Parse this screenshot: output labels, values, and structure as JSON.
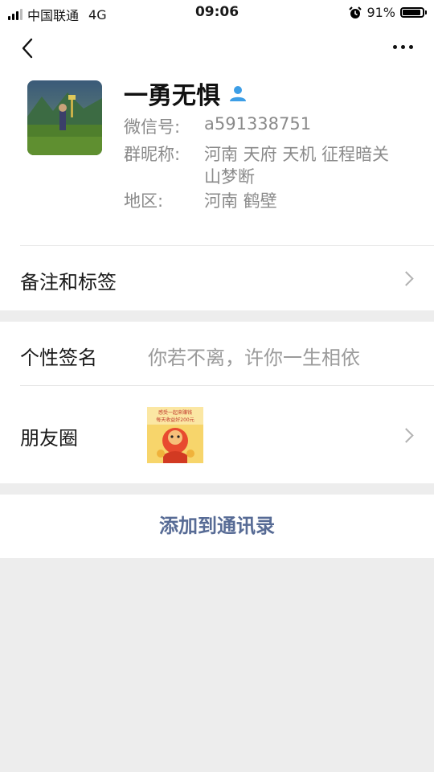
{
  "status_bar": {
    "carrier": "中国联通",
    "network": "4G",
    "time": "09:06",
    "battery_percent": "91%",
    "battery_level": 0.91
  },
  "nav": {
    "back_icon": "chevron-left-icon",
    "more_icon": "more-dots-icon"
  },
  "profile": {
    "nickname": "一勇无惧",
    "gender_icon": "person-icon",
    "wechat_id_label": "微信号:",
    "wechat_id": "a591338751",
    "group_nick_label": "群昵称:",
    "group_nick_line1": "河南 天府 天机 征程暗关",
    "group_nick_line2": "山梦断",
    "region_label": "地区:",
    "region": "河南 鹤壁"
  },
  "rows": {
    "remarks_label": "备注和标签",
    "signature_label": "个性签名",
    "signature_value": "你若不离，许你一生相依",
    "moments_label": "朋友圈"
  },
  "moments_thumb": {
    "line1": "感受一起来赚钱",
    "line2": "每天收益好200元"
  },
  "actions": {
    "add_contact": "添加到通讯录"
  },
  "colors": {
    "link_blue": "#576b95",
    "page_bg": "#ededed",
    "gender_icon": "#3d9ee6"
  }
}
